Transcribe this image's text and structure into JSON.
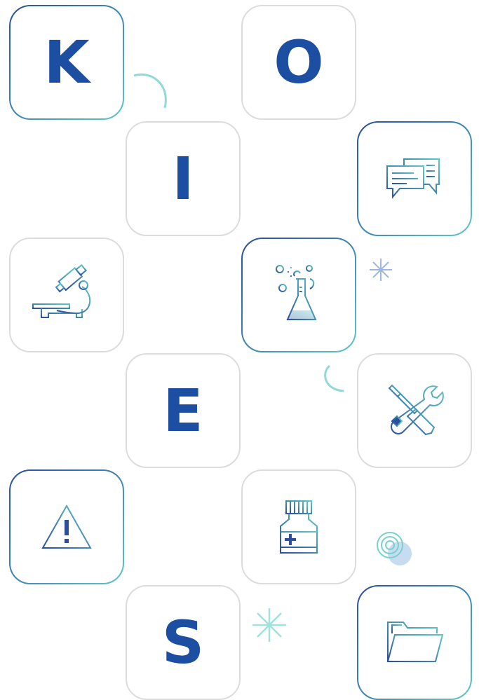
{
  "colors": {
    "letter": "#1c4ea2",
    "gradient_dark": "#2b4f9c",
    "gradient_light": "#5ec8c7",
    "tile_border_gray": "#dcdcdc"
  },
  "letters": {
    "k": "K",
    "o": "O",
    "i": "I",
    "e": "E",
    "s": "S"
  },
  "icons": [
    "chat-bubbles-icon",
    "microscope-icon",
    "flask-icon",
    "tools-icon",
    "warning-icon",
    "medicine-bottle-icon",
    "folder-icon"
  ]
}
